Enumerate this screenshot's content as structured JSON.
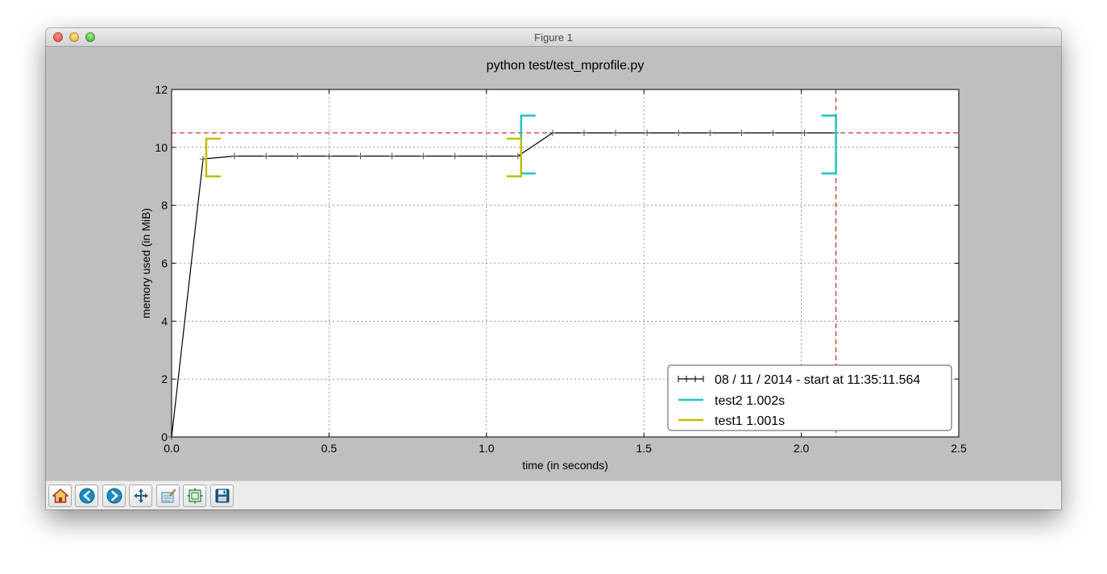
{
  "window": {
    "title": "Figure 1"
  },
  "toolbar": {
    "buttons": [
      {
        "name": "home-button",
        "icon": "home-icon"
      },
      {
        "name": "back-button",
        "icon": "back-arrow-icon"
      },
      {
        "name": "forward-button",
        "icon": "forward-arrow-icon"
      },
      {
        "name": "pan-button",
        "icon": "move-icon"
      },
      {
        "name": "zoom-button",
        "icon": "zoom-rect-icon"
      },
      {
        "name": "subplots-button",
        "icon": "subplots-icon"
      },
      {
        "name": "save-button",
        "icon": "floppy-disk-icon"
      }
    ]
  },
  "chart_data": {
    "type": "line",
    "title": "python test/test_mprofile.py",
    "xlabel": "time (in seconds)",
    "ylabel": "memory used (in MiB)",
    "xlim": [
      0.0,
      2.5
    ],
    "ylim": [
      0,
      12
    ],
    "xticks": [
      "0.0",
      "0.5",
      "1.0",
      "1.5",
      "2.0",
      "2.5"
    ],
    "yticks": [
      "0",
      "2",
      "4",
      "6",
      "8",
      "10",
      "12"
    ],
    "grid": true,
    "legend_position": "bottom-right",
    "series": [
      {
        "name": "08 / 11 / 2014 - start at 11:35:11.564",
        "color": "#000000",
        "marker": "+",
        "x": [
          0.0,
          0.1,
          0.2,
          0.3,
          0.4,
          0.5,
          0.6,
          0.7,
          0.8,
          0.9,
          1.0,
          1.1,
          1.21,
          1.31,
          1.41,
          1.51,
          1.61,
          1.71,
          1.81,
          1.91,
          2.01,
          2.11
        ],
        "y": [
          0.0,
          9.6,
          9.7,
          9.7,
          9.7,
          9.7,
          9.7,
          9.7,
          9.7,
          9.7,
          9.7,
          9.7,
          10.5,
          10.5,
          10.5,
          10.5,
          10.5,
          10.5,
          10.5,
          10.5,
          10.5,
          10.5
        ]
      }
    ],
    "brackets": [
      {
        "name": "test2 1.002s",
        "color": "#22c3c3",
        "x_start": 1.11,
        "x_end": 2.11,
        "y_start": 9.1,
        "y_end": 11.1
      },
      {
        "name": "test1 1.001s",
        "color": "#bfbf00",
        "x_start": 0.11,
        "x_end": 1.11,
        "y_start": 9.0,
        "y_end": 10.3
      }
    ],
    "max_line": {
      "color": "#cc0000",
      "x": 2.11,
      "y": 10.5
    }
  }
}
